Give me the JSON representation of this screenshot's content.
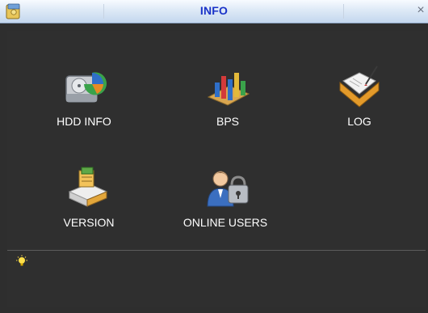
{
  "window": {
    "title": "INFO",
    "close_glyph": "×",
    "app_icon": "folder-icon"
  },
  "tiles": [
    {
      "label": "HDD INFO",
      "icon": "hdd-icon"
    },
    {
      "label": "BPS",
      "icon": "bar-chart-icon"
    },
    {
      "label": "LOG",
      "icon": "log-book-icon"
    },
    {
      "label": "VERSION",
      "icon": "version-box-icon"
    },
    {
      "label": "ONLINE USERS",
      "icon": "online-users-icon"
    }
  ],
  "status": {
    "icon": "lightbulb-icon",
    "text": ""
  },
  "colors": {
    "background": "#2e2e2e",
    "title_text": "#1a33c8",
    "label_text": "#ffffff"
  }
}
